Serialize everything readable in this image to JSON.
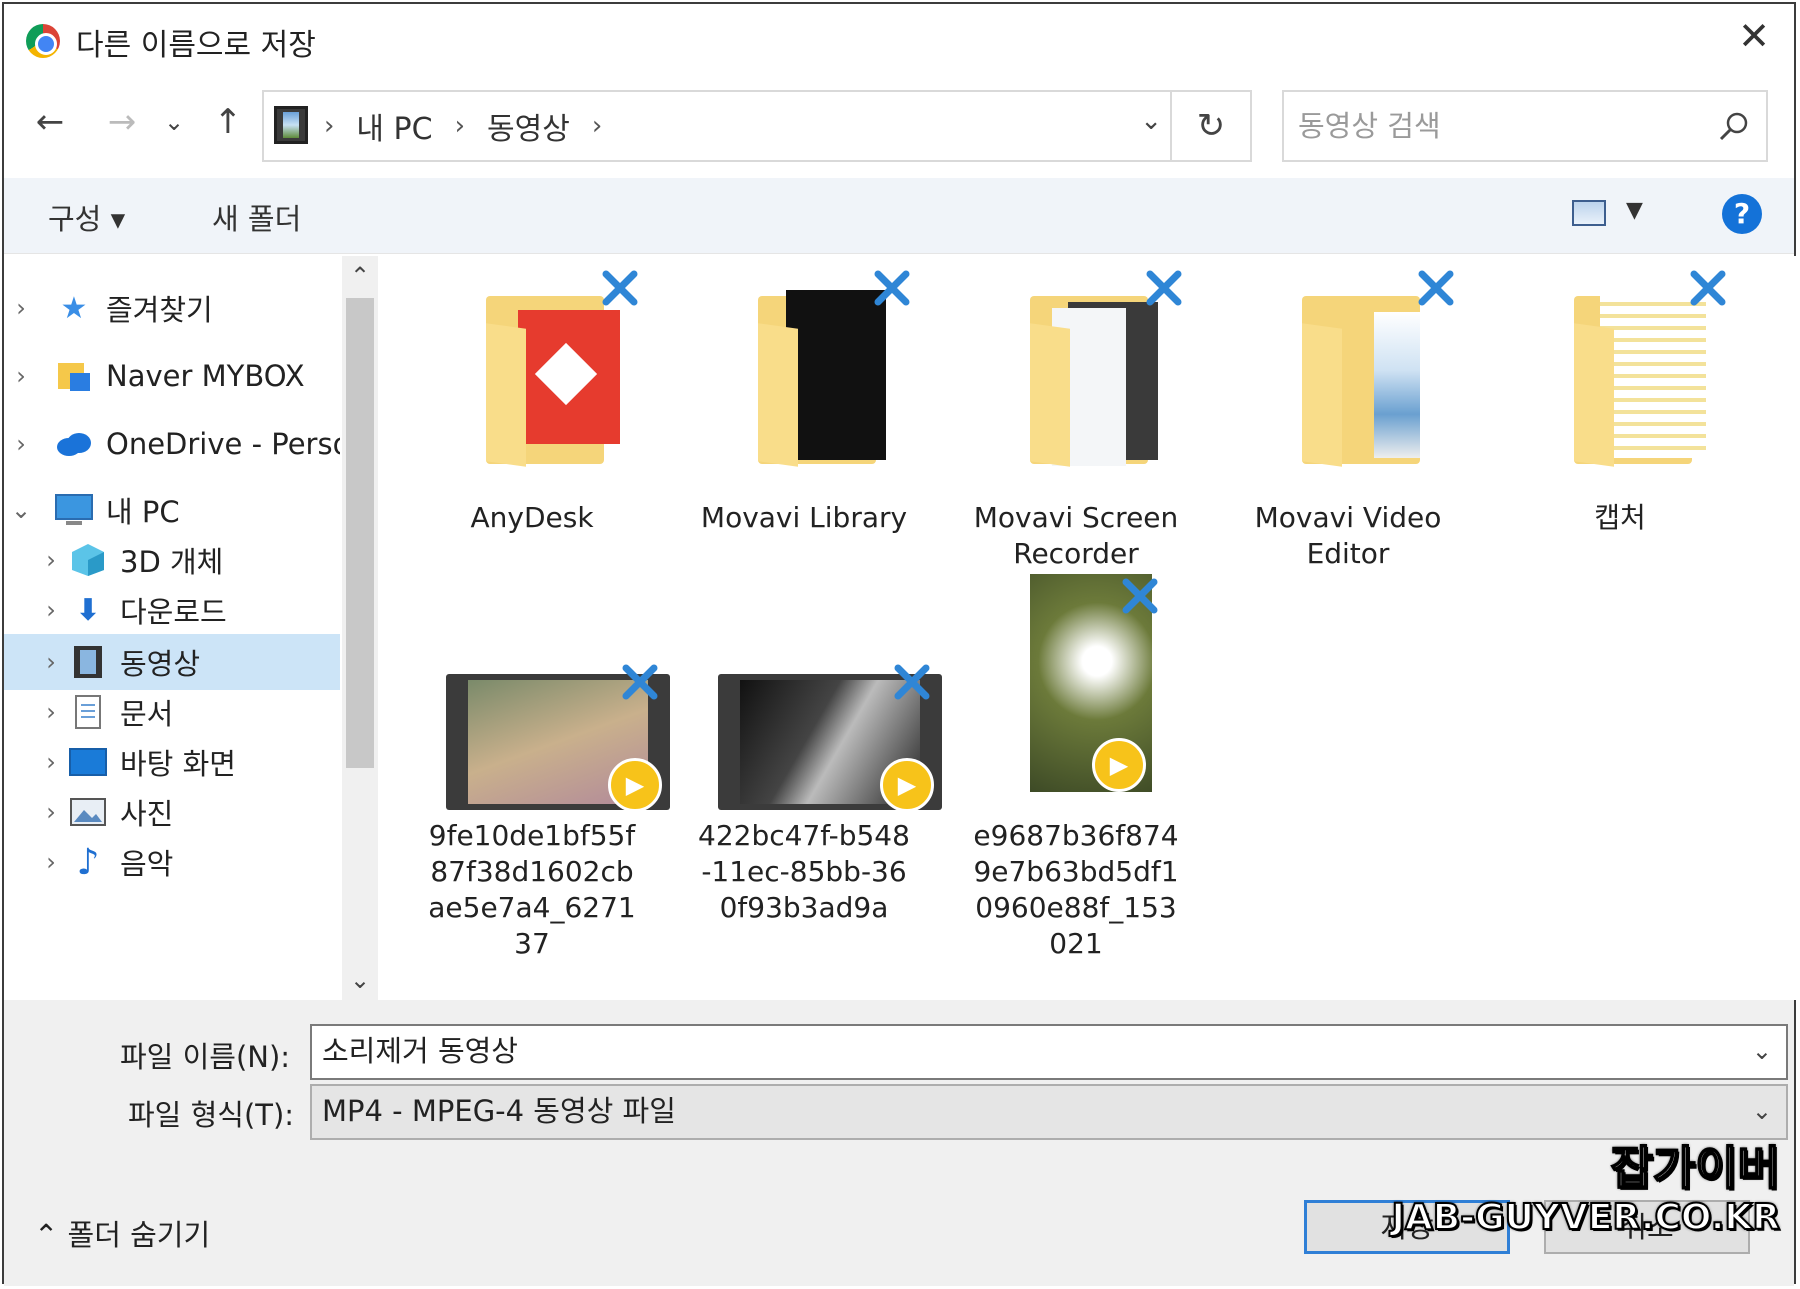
{
  "window": {
    "title": "다른 이름으로 저장",
    "close": "✕"
  },
  "nav": {
    "back": "←",
    "forward": "→",
    "recent": "⌄",
    "up": "↑"
  },
  "address": {
    "crumbs": [
      "내 PC",
      "동영상"
    ],
    "refresh": "↻"
  },
  "search": {
    "placeholder": "동영상 검색"
  },
  "toolbar": {
    "organize": "구성 ▾",
    "new_folder": "새 폴더",
    "help": "?"
  },
  "sidebar": {
    "items": [
      {
        "label": "즐겨찾기",
        "chev": "›",
        "icon": "star-icon"
      },
      {
        "label": "Naver MYBOX",
        "chev": "›",
        "icon": "mybox-icon"
      },
      {
        "label": "OneDrive - Personal",
        "chev": "›",
        "icon": "cloud-icon"
      },
      {
        "label": "내 PC",
        "chev": "⌄",
        "icon": "pc-icon"
      },
      {
        "label": "3D 개체",
        "chev": "›",
        "icon": "cube-icon"
      },
      {
        "label": "다운로드",
        "chev": "›",
        "icon": "download-icon"
      },
      {
        "label": "동영상",
        "chev": "›",
        "icon": "video-icon"
      },
      {
        "label": "문서",
        "chev": "›",
        "icon": "document-icon"
      },
      {
        "label": "바탕 화면",
        "chev": "›",
        "icon": "desktop-icon"
      },
      {
        "label": "사진",
        "chev": "›",
        "icon": "picture-icon"
      },
      {
        "label": "음악",
        "chev": "›",
        "icon": "music-icon"
      }
    ],
    "scroll_up": "⌃",
    "scroll_down": "⌄"
  },
  "files": [
    {
      "name": "AnyDesk",
      "type": "folder"
    },
    {
      "name": "Movavi Library",
      "type": "folder"
    },
    {
      "name": "Movavi Screen Recorder",
      "type": "folder"
    },
    {
      "name": "Movavi Video Editor",
      "type": "folder"
    },
    {
      "name": "캡처",
      "type": "folder"
    },
    {
      "name": "9fe10de1bf55f87f38d1602cbae5e7a4_627137",
      "type": "video"
    },
    {
      "name": "422bc47f-b548-11ec-85bb-360f93b3ad9a",
      "type": "video"
    },
    {
      "name": "e9687b36f8749e7b63bd5df10960e88f_153021",
      "type": "video"
    }
  ],
  "bottom": {
    "filename_label": "파일 이름(N):",
    "filename_value": "소리제거 동영상",
    "filetype_label": "파일 형식(T):",
    "filetype_value": "MP4 - MPEG-4 동영상 파일",
    "hide_folders": "⌃  폴더 숨기기",
    "save": "저장",
    "cancel": "취소"
  },
  "watermark": {
    "line1": "잡가이버",
    "line2": "JAB-GUYVER.CO.KR"
  },
  "colors": {
    "accent": "#1472d8",
    "selection": "#cce4f7",
    "folder": "#f5d57a"
  }
}
